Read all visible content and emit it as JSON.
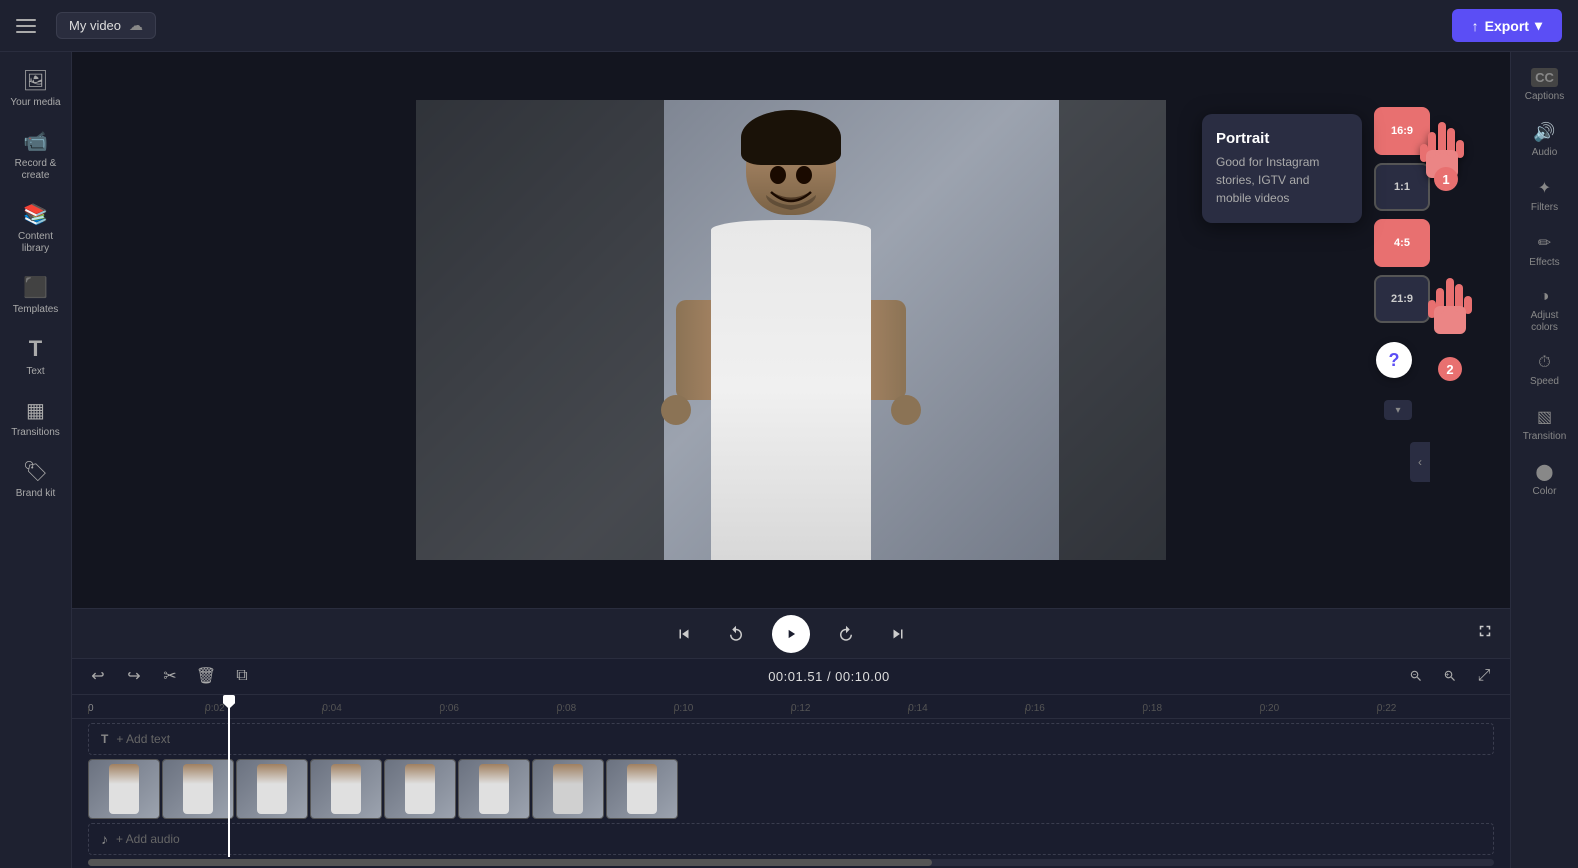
{
  "topbar": {
    "hamburger_label": "Menu",
    "title": "My video",
    "cloud_icon": "☁",
    "export_label": "Export",
    "export_arrow": "↑",
    "export_chevron": "▾"
  },
  "left_sidebar": {
    "items": [
      {
        "id": "your-media",
        "icon": "🖼",
        "label": "Your media"
      },
      {
        "id": "record",
        "icon": "📹",
        "label": "Record &\ncreate"
      },
      {
        "id": "content-library",
        "icon": "📚",
        "label": "Content\nlibrary"
      },
      {
        "id": "templates",
        "icon": "⬛",
        "label": "Templates"
      },
      {
        "id": "text",
        "icon": "T",
        "label": "Text"
      },
      {
        "id": "transitions",
        "icon": "▦",
        "label": "Transitions"
      },
      {
        "id": "brand-kit",
        "icon": "🏷",
        "label": "Brand kit"
      }
    ]
  },
  "right_sidebar": {
    "items": [
      {
        "id": "captions",
        "icon": "CC",
        "label": "Captions"
      },
      {
        "id": "audio",
        "icon": "🔊",
        "label": "Audio"
      },
      {
        "id": "filters",
        "icon": "✦",
        "label": "Filters"
      },
      {
        "id": "effects",
        "icon": "✏",
        "label": "Effects"
      },
      {
        "id": "adjust-colors",
        "icon": "◑",
        "label": "Adjust\ncolors"
      },
      {
        "id": "speed",
        "icon": "⏱",
        "label": "Speed"
      },
      {
        "id": "transition",
        "icon": "▧",
        "label": "Transition"
      },
      {
        "id": "color",
        "icon": "⬤",
        "label": "Color"
      }
    ]
  },
  "aspect_tooltip": {
    "title": "Portrait",
    "description": "Good for Instagram stories, IGTV and mobile videos"
  },
  "aspect_ratios": [
    {
      "id": "16-9",
      "label": "16:9",
      "active": true
    },
    {
      "id": "1-1",
      "label": "1:1",
      "active": false
    },
    {
      "id": "4-5",
      "label": "4:5",
      "active": true
    },
    {
      "id": "21-9",
      "label": "21:9",
      "active": false
    }
  ],
  "video_controls": {
    "skip_start": "⏮",
    "rewind": "↺",
    "play": "▶",
    "forward": "↻",
    "skip_end": "⏭",
    "fullscreen": "⛶"
  },
  "timeline": {
    "time_current": "00:01.51",
    "time_total": "00:10.00",
    "time_separator": "/",
    "undo_icon": "↩",
    "redo_icon": "↪",
    "cut_icon": "✂",
    "delete_icon": "🗑",
    "duplicate_icon": "⧉",
    "zoom_out_icon": "🔍",
    "zoom_in_icon": "🔍",
    "expand_icon": "⤢",
    "ruler_marks": [
      "0",
      "0:02",
      "0:04",
      "0:06",
      "0:08",
      "0:10",
      "0:12",
      "0:14",
      "0:16",
      "0:18",
      "0:20",
      "0:22"
    ],
    "text_track_label": "+ Add text",
    "audio_track_label": "+ Add audio"
  },
  "hands": {
    "cursor": "👆",
    "badge_1": "1",
    "badge_2": "2"
  }
}
